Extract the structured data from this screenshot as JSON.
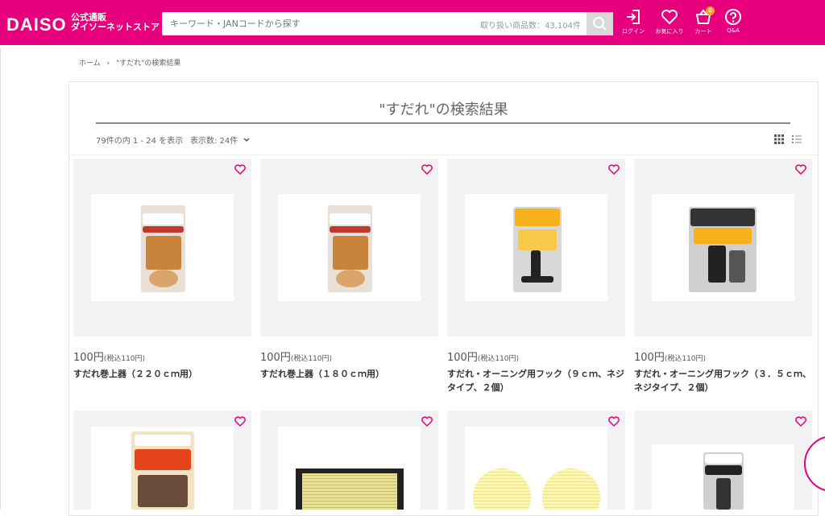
{
  "header": {
    "logo": "DAISO",
    "logo_sub_1": "公式通販",
    "logo_sub_2": "ダイソーネットストア",
    "search_placeholder": "キーワード・JANコードから探す",
    "item_count": "取り扱い商品数：43,104件",
    "icons": [
      {
        "name": "login-icon",
        "label": "ログイン"
      },
      {
        "name": "favorite-icon",
        "label": "お気に入り"
      },
      {
        "name": "cart-icon",
        "label": "カート",
        "badge": "0"
      },
      {
        "name": "help-icon",
        "label": "Q&A"
      }
    ]
  },
  "breadcrumb": [
    "ホーム",
    "›",
    "\"すだれ\"の検索結果"
  ],
  "results": {
    "title": "\"すだれ\"の検索結果",
    "count_text": "79件の内 1 - 24 を表示",
    "per_page": "表示数: 24件"
  },
  "products": [
    {
      "price": "100円",
      "tax": "(税込110円)",
      "name": "すだれ巻上器（２２０ｃｍ用）"
    },
    {
      "price": "100円",
      "tax": "(税込110円)",
      "name": "すだれ巻上器（１８０ｃｍ用）"
    },
    {
      "price": "100円",
      "tax": "(税込110円)",
      "name": "すだれ・オーニング用フック（９ｃｍ、ネジタイプ、２個）"
    },
    {
      "price": "100円",
      "tax": "(税込110円)",
      "name": "すだれ・オーニング用フック（３．５ｃｍ、ネジタイプ、２個）"
    }
  ],
  "colors": {
    "brand": "#e6007e",
    "card_bg": "#f2f2f2"
  }
}
